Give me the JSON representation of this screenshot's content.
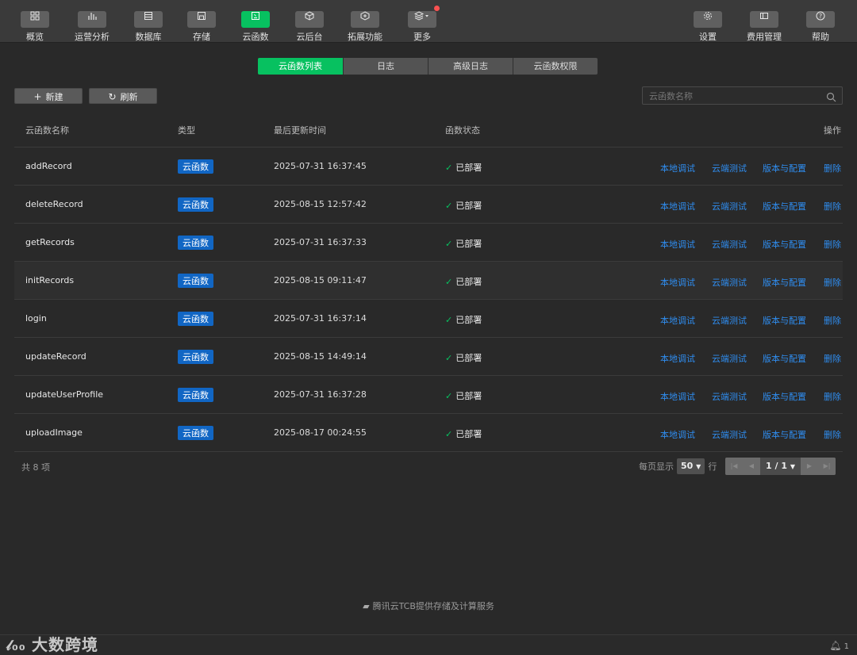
{
  "toolbar": {
    "items": [
      {
        "label": "概览",
        "icon": "grid-icon"
      },
      {
        "label": "运营分析",
        "icon": "bar-chart-icon"
      },
      {
        "label": "数据库",
        "icon": "database-icon"
      },
      {
        "label": "存储",
        "icon": "storage-icon"
      },
      {
        "label": "云函数",
        "icon": "function-icon"
      },
      {
        "label": "云后台",
        "icon": "cube-icon"
      },
      {
        "label": "拓展功能",
        "icon": "extension-icon"
      },
      {
        "label": "更多",
        "icon": "layers-icon"
      },
      {
        "label": "设置",
        "icon": "gear-icon"
      },
      {
        "label": "费用管理",
        "icon": "wallet-icon"
      },
      {
        "label": "帮助",
        "icon": "help-icon"
      }
    ],
    "active": "云函数",
    "accent": "#07c160"
  },
  "tabs": [
    "云函数列表",
    "日志",
    "高级日志",
    "云函数权限"
  ],
  "actions": {
    "new_label": "新建",
    "refresh_label": "刷新"
  },
  "search": {
    "placeholder": "云函数名称"
  },
  "table": {
    "headers": {
      "name": "云函数名称",
      "type": "类型",
      "time": "最后更新时间",
      "status": "函数状态",
      "ops": "操作"
    },
    "rows": [
      {
        "name": "addRecord",
        "type": "云函数",
        "time": "2025-07-31 16:37:45",
        "status": "已部署"
      },
      {
        "name": "deleteRecord",
        "type": "云函数",
        "time": "2025-08-15 12:57:42",
        "status": "已部署"
      },
      {
        "name": "getRecords",
        "type": "云函数",
        "time": "2025-07-31 16:37:33",
        "status": "已部署"
      },
      {
        "name": "initRecords",
        "type": "云函数",
        "time": "2025-08-15 09:11:47",
        "status": "已部署"
      },
      {
        "name": "login",
        "type": "云函数",
        "time": "2025-07-31 16:37:14",
        "status": "已部署"
      },
      {
        "name": "updateRecord",
        "type": "云函数",
        "time": "2025-08-15 14:49:14",
        "status": "已部署"
      },
      {
        "name": "updateUserProfile",
        "type": "云函数",
        "time": "2025-07-31 16:37:28",
        "status": "已部署"
      },
      {
        "name": "uploadImage",
        "type": "云函数",
        "time": "2025-08-17 00:24:55",
        "status": "已部署"
      }
    ],
    "row_actions": [
      "本地调试",
      "云端测试",
      "版本与配置",
      "删除"
    ]
  },
  "footer": {
    "total": "共 8 项",
    "per_page_label": "每页显示",
    "per_page_value": "50",
    "per_page_unit": "行",
    "page": "1 / 1"
  },
  "credit": "腾讯云TCB提供存储及计算服务",
  "logo_text": "大数跨境",
  "notification_count": "1"
}
